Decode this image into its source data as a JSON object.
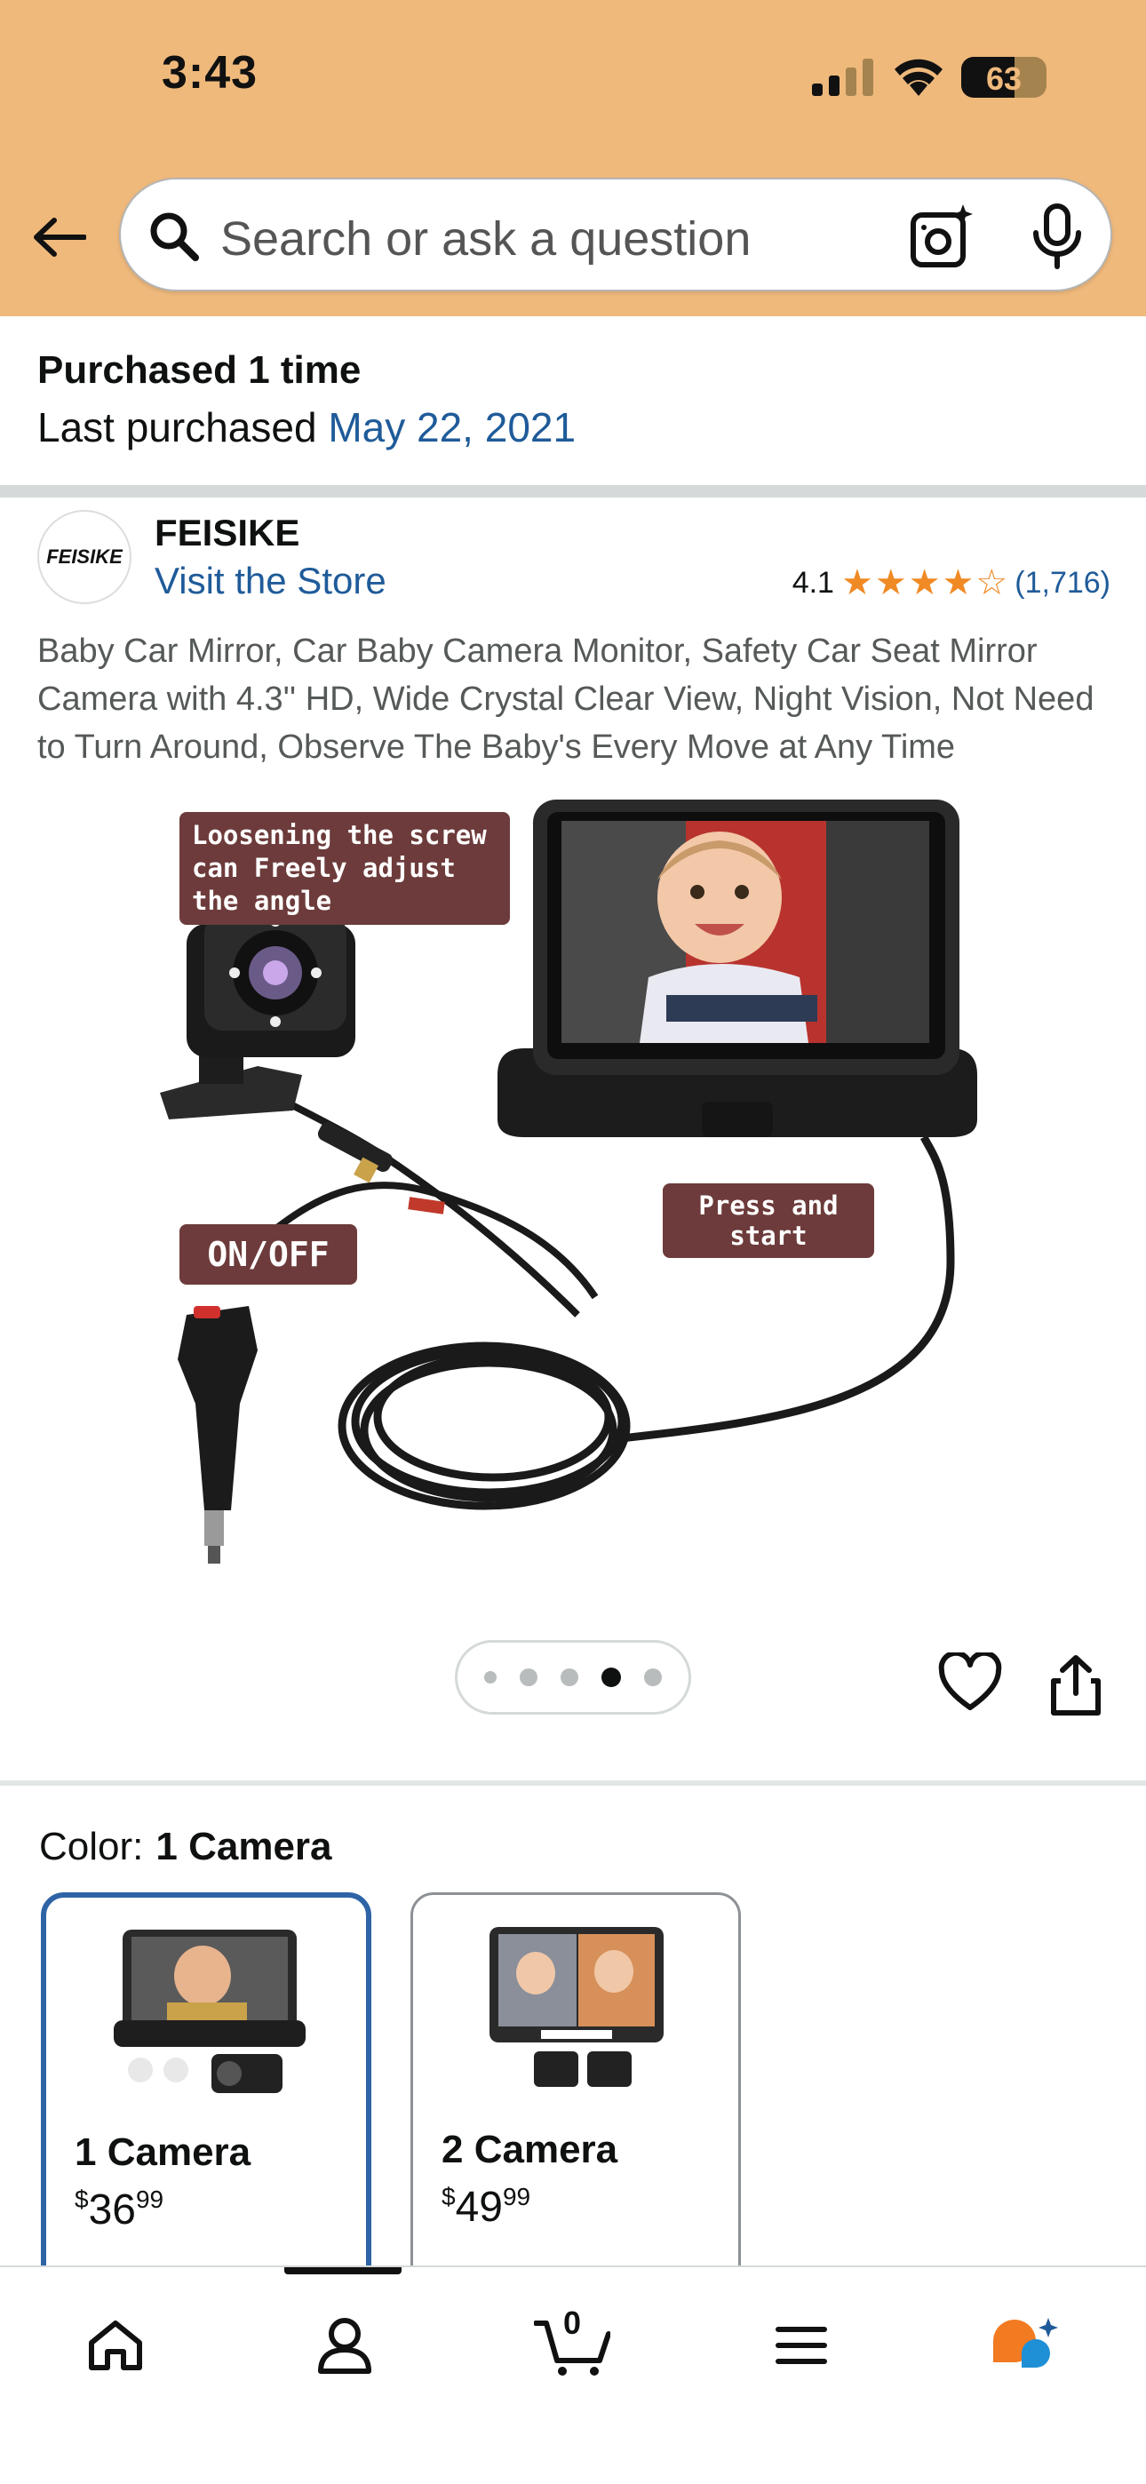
{
  "status_bar": {
    "time": "3:43",
    "battery": "63",
    "battery_level": 0.63
  },
  "header": {
    "back_icon": "arrow-left-icon",
    "search_placeholder": "Search or ask a question",
    "camera_icon": "camera-search-icon",
    "mic_icon": "microphone-icon"
  },
  "purchase": {
    "title": "Purchased 1 time",
    "last_label": "Last purchased",
    "last_date": "May 22, 2021"
  },
  "brand": {
    "logo_text": "FEISIKE",
    "name": "FEISIKE",
    "visit_store": "Visit the Store",
    "rating": "4.1",
    "stars": 4.1,
    "rating_count": "(1,716)"
  },
  "product": {
    "title": "Baby Car Mirror, Car Baby Camera Monitor, Safety Car Seat Mirror Camera with 4.3'' HD, Wide Crystal Clear View, Night Vision, Not Need to Turn Around, Observe The Baby's Every Move at Any Time",
    "image_callouts": {
      "screw": "Loosening the screw can Freely adjust the angle",
      "press": "Press and start",
      "onoff": "ON/OFF"
    },
    "image_count": 5,
    "active_image_index": 3,
    "heart_icon": "heart-icon",
    "share_icon": "share-icon"
  },
  "color": {
    "label": "Color:",
    "selected": "1 Camera",
    "options": [
      {
        "name": "1 Camera",
        "price_dollars": "36",
        "price_cents": "99",
        "currency": "$"
      },
      {
        "name": "2 Camera",
        "price_dollars": "49",
        "price_cents": "99",
        "currency": "$"
      }
    ]
  },
  "bottom_nav": {
    "items": [
      "home-icon",
      "account-icon",
      "cart-icon",
      "menu-icon",
      "rufus-icon"
    ],
    "cart_count": "0"
  },
  "colors": {
    "header_bg": "#efb97c",
    "link": "#1f5b99",
    "star": "#f08a24",
    "selected_border": "#2e64a6",
    "callout_bg": "#6d3b3b"
  }
}
